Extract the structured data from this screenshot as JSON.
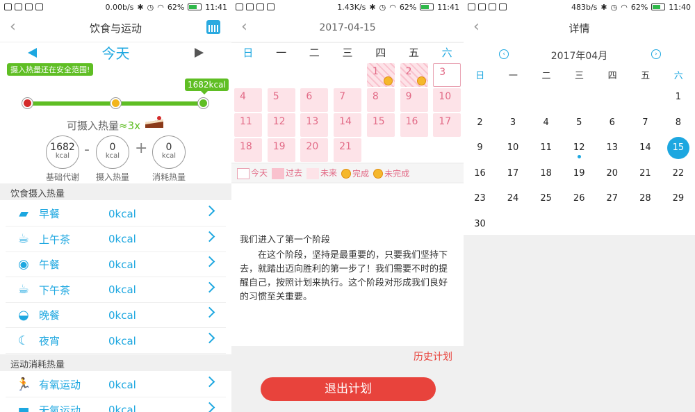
{
  "status_bars": [
    {
      "speed": "0.00b/s",
      "battery": "62%",
      "time": "11:41"
    },
    {
      "speed": "1.43K/s",
      "battery": "62%",
      "time": "11:41"
    },
    {
      "speed": "483b/s",
      "battery": "62%",
      "time": "11:40"
    }
  ],
  "p1": {
    "title": "饮食与运动",
    "today": "今天",
    "safe_badge": "摄入热量还在安全范围!",
    "kcal_badge": "1682kcal",
    "can_eat": "可摄入热量",
    "multiplier": "≈3x",
    "stats": [
      {
        "value": "1682",
        "unit": "kcal",
        "label": "基础代谢"
      },
      {
        "value": "0",
        "unit": "kcal",
        "label": "摄入热量"
      },
      {
        "value": "0",
        "unit": "kcal",
        "label": "消耗热量"
      }
    ],
    "ops": [
      "-",
      "+"
    ],
    "intake_header": "饮食摄入热量",
    "meals": [
      {
        "icon": "cake-icon",
        "glyph": "▰",
        "name": "早餐",
        "value": "0kcal"
      },
      {
        "icon": "teacup-icon",
        "glyph": "☕",
        "name": "上午茶",
        "value": "0kcal"
      },
      {
        "icon": "plate-icon",
        "glyph": "◉",
        "name": "午餐",
        "value": "0kcal"
      },
      {
        "icon": "teacup-icon",
        "glyph": "☕",
        "name": "下午茶",
        "value": "0kcal"
      },
      {
        "icon": "cloche-icon",
        "glyph": "◒",
        "name": "晚餐",
        "value": "0kcal"
      },
      {
        "icon": "moon-icon",
        "glyph": "☾",
        "name": "夜宵",
        "value": "0kcal"
      }
    ],
    "exercise_header": "运动消耗热量",
    "exercises": [
      {
        "icon": "runner-icon",
        "glyph": "🏃",
        "name": "有氧运动",
        "value": "0kcal"
      },
      {
        "icon": "dumbbell-icon",
        "glyph": "▬",
        "name": "无氧运动",
        "value": "0kcal"
      }
    ]
  },
  "p2": {
    "title": "2017-04-15",
    "weekdays": [
      "日",
      "一",
      "二",
      "三",
      "四",
      "五",
      "六"
    ],
    "days": [
      "1",
      "2",
      "3",
      "4",
      "5",
      "6",
      "7",
      "8",
      "9",
      "10",
      "11",
      "12",
      "13",
      "14",
      "15",
      "16",
      "17",
      "18",
      "19",
      "20",
      "21"
    ],
    "completed_days": [
      "1",
      "2"
    ],
    "today_day": "3",
    "legend": [
      "今天",
      "过去",
      "未来",
      "完成",
      "未完成"
    ],
    "stage_title": "我们进入了第一个阶段",
    "stage_body": "在这个阶段，坚持是最重要的，只要我们坚持下去，就踏出迈向胜利的第一步了！我们需要不时的提醒自己，按照计划来执行。这个阶段对形成我们良好的习惯至关重要。",
    "history": "历史计划",
    "quit": "退出计划"
  },
  "p3": {
    "title": "详情",
    "month": "2017年04月",
    "weekdays": [
      "日",
      "一",
      "二",
      "三",
      "四",
      "五",
      "六"
    ],
    "days": [
      "1",
      "2",
      "3",
      "4",
      "5",
      "6",
      "7",
      "8",
      "9",
      "10",
      "11",
      "12",
      "13",
      "14",
      "15",
      "16",
      "17",
      "18",
      "19",
      "20",
      "21",
      "22",
      "23",
      "24",
      "25",
      "26",
      "27",
      "28",
      "29",
      "30"
    ],
    "first_weekday": 6,
    "selected": "15",
    "marked": "12"
  },
  "colors": {
    "accent": "#1da7e0",
    "green": "#5fbe24",
    "red": "#e8433c",
    "pink": "#fde3e8"
  }
}
